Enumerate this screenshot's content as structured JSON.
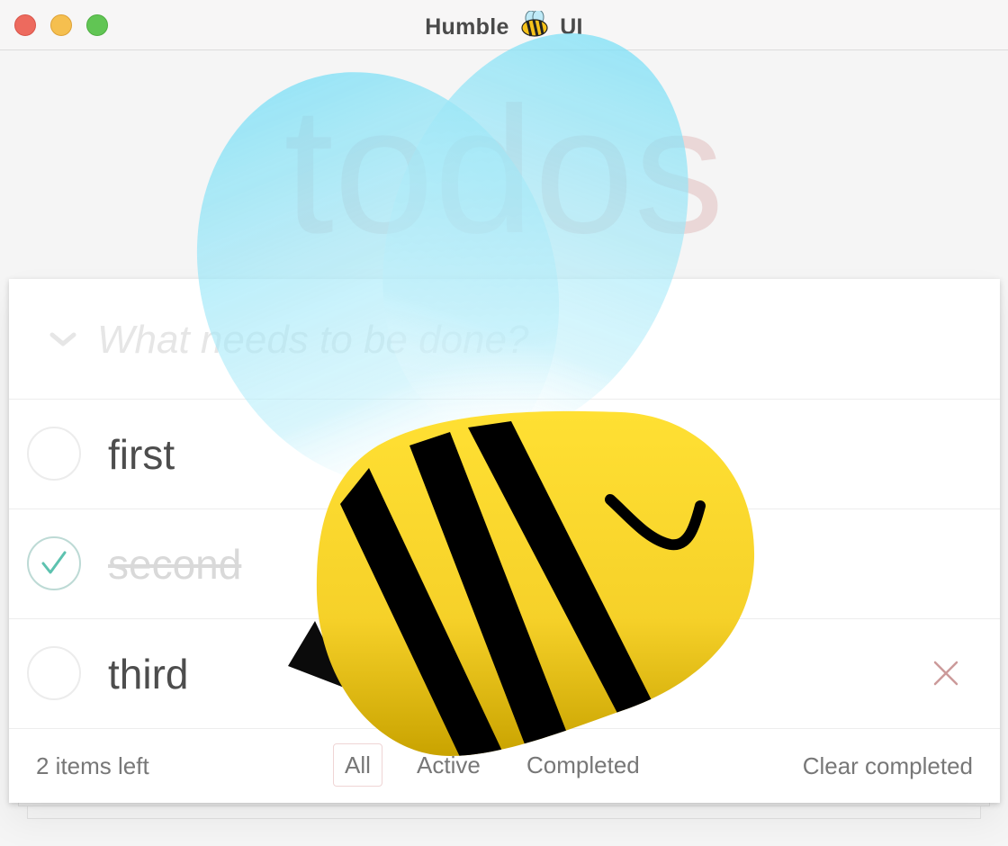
{
  "window": {
    "title_left": "Humble",
    "title_right": "UI",
    "title_icon": "bee-icon"
  },
  "app": {
    "heading": "todos",
    "new_todo_placeholder": "What needs to be done?",
    "todos": [
      {
        "label": "first",
        "completed": false
      },
      {
        "label": "second",
        "completed": true
      },
      {
        "label": "third",
        "completed": false
      }
    ],
    "footer": {
      "items_left": "2 items left",
      "filters": [
        "All",
        "Active",
        "Completed"
      ],
      "selected_filter": "All",
      "clear_completed": "Clear completed"
    }
  },
  "colors": {
    "heading": "#af2f2f",
    "check_done": "#5dc2af",
    "destroy": "#cc9a9a",
    "bee_body": "#fcd92b",
    "bee_wing": "#8ee3f7"
  }
}
